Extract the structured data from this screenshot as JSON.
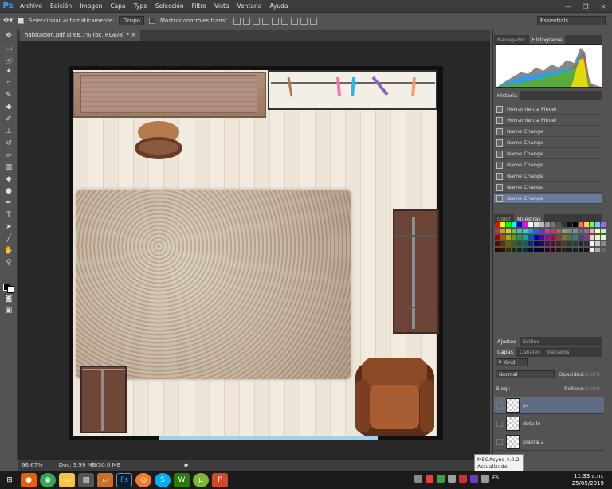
{
  "app": {
    "logo": "Ps",
    "menu": [
      "Archivo",
      "Edición",
      "Imagen",
      "Capa",
      "Type",
      "Selección",
      "Filtro",
      "Vista",
      "Ventana",
      "Ayuda"
    ],
    "window_controls": [
      "—",
      "❐",
      "✕"
    ]
  },
  "options": {
    "auto_select": "Seleccionar automáticamente:",
    "group_value": "Grupo",
    "show_transform": "Mostrar controles transf.",
    "workspace": "Essentials"
  },
  "document": {
    "tab_title": "habitacion.pdf al 66,7% (pc, RGB/8) *",
    "close": "×"
  },
  "status": {
    "zoom": "66,67%",
    "doc_info": "Doc: 3,99 MB/30,0 MB"
  },
  "panels": {
    "top_tabs": [
      "Navegador",
      "Histograma"
    ],
    "history_title": "Historia",
    "history_items": [
      "Herramienta Pincel",
      "Herramienta Pincel",
      "Name Change",
      "Name Change",
      "Name Change",
      "Name Change",
      "Name Change",
      "Name Change",
      "Name Change"
    ],
    "color_tabs": [
      "Color",
      "Muestras"
    ],
    "adjust_tabs": [
      "Ajustes",
      "Estilos"
    ],
    "layers_tabs": [
      "Capas",
      "Canales",
      "Trazados"
    ],
    "filter_kind": "Kind",
    "blend_mode": "Normal",
    "opacity_label": "Opacidad:",
    "opacity_value": "100%",
    "lock_label": "Bloq.:",
    "fill_label": "Relleno:",
    "fill_value": "100%",
    "layers": [
      "pc",
      "detalle",
      "planta 2"
    ]
  },
  "tooltip": {
    "line1": "MEGAsync 4.0.2",
    "line2": "Actualizado"
  },
  "clock": {
    "time": "11:33 a.m.",
    "date": "25/05/2019"
  },
  "taskbar": {
    "lang": "ES"
  },
  "colors": {
    "accent": "#31a8ff",
    "selection": "#5f6a83"
  }
}
